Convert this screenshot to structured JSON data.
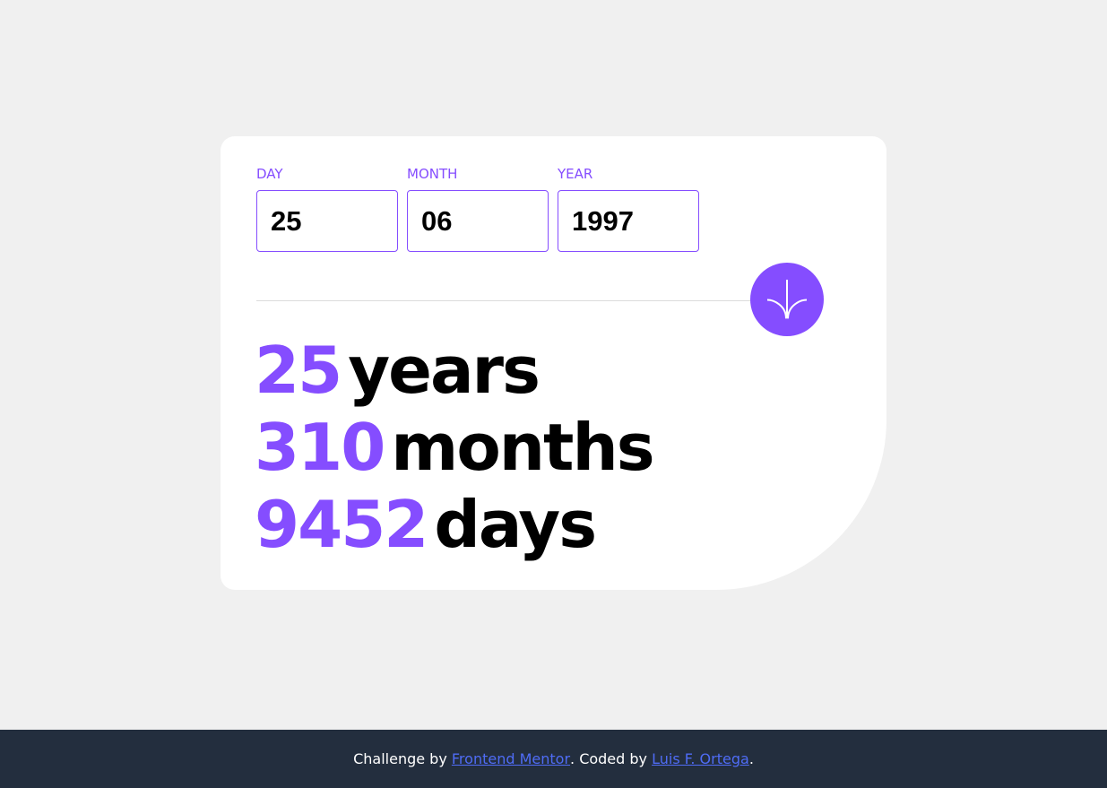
{
  "form": {
    "fields": [
      {
        "label": "DAY",
        "value": "25"
      },
      {
        "label": "MONTH",
        "value": "06"
      },
      {
        "label": "YEAR",
        "value": "1997"
      }
    ],
    "submit_icon": "arrow-down-icon"
  },
  "results": [
    {
      "value": "25",
      "unit": "years"
    },
    {
      "value": "310",
      "unit": "months"
    },
    {
      "value": "9452",
      "unit": "days"
    }
  ],
  "footer": {
    "prefix": "Challenge by ",
    "link1": "Frontend Mentor",
    "middle": ". Coded by ",
    "link2": "Luis F. Ortega",
    "suffix": "."
  },
  "colors": {
    "accent": "#854dff",
    "background": "#f0f0f0",
    "card": "#ffffff",
    "footer": "#232e3e",
    "link": "#4f6cf5"
  }
}
